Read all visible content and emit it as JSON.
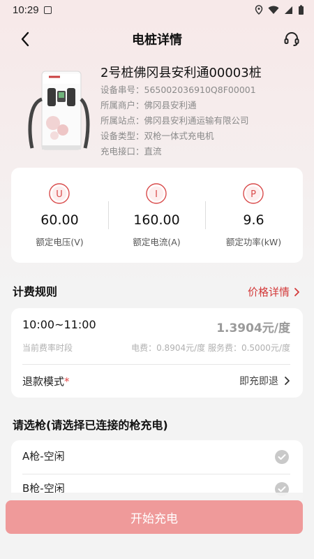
{
  "status_bar": {
    "time": "10:29"
  },
  "nav": {
    "title": "电桩详情"
  },
  "device": {
    "name": "2号桩佛冈县安利通00003桩",
    "info": [
      "设备串号：565002036910Q8F00001",
      "所属商户：佛冈县安利通",
      "所属站点：佛冈县安利通运输有限公司",
      "设备类型：双枪一体式充电机",
      "充电接口：直流"
    ]
  },
  "specs": [
    {
      "icon": "U",
      "value": "60.00",
      "label": "额定电压(V)"
    },
    {
      "icon": "I",
      "value": "160.00",
      "label": "额定电流(A)"
    },
    {
      "icon": "P",
      "value": "9.6",
      "label": "额定功率(kW)"
    }
  ],
  "billing": {
    "title": "计费规则",
    "detail_link": "价格详情",
    "period": "10:00~11:00",
    "price": "1.3904元/度",
    "current_label": "当前费率时段",
    "fee_text": "电费：0.8904元/度 服务费：0.5000元/度",
    "refund_label": "退款模式",
    "refund_required_mark": "*",
    "refund_value": "即充即退"
  },
  "guns": {
    "title": "请选枪(请选择已连接的枪充电)",
    "items": [
      {
        "label": "A枪-空闲"
      },
      {
        "label": "B枪-空闲"
      }
    ]
  },
  "start_button": "开始充电",
  "colors": {
    "accent": "#d33a3a",
    "button": "#ef9a9a",
    "header_bg": "#f7e9e9"
  }
}
